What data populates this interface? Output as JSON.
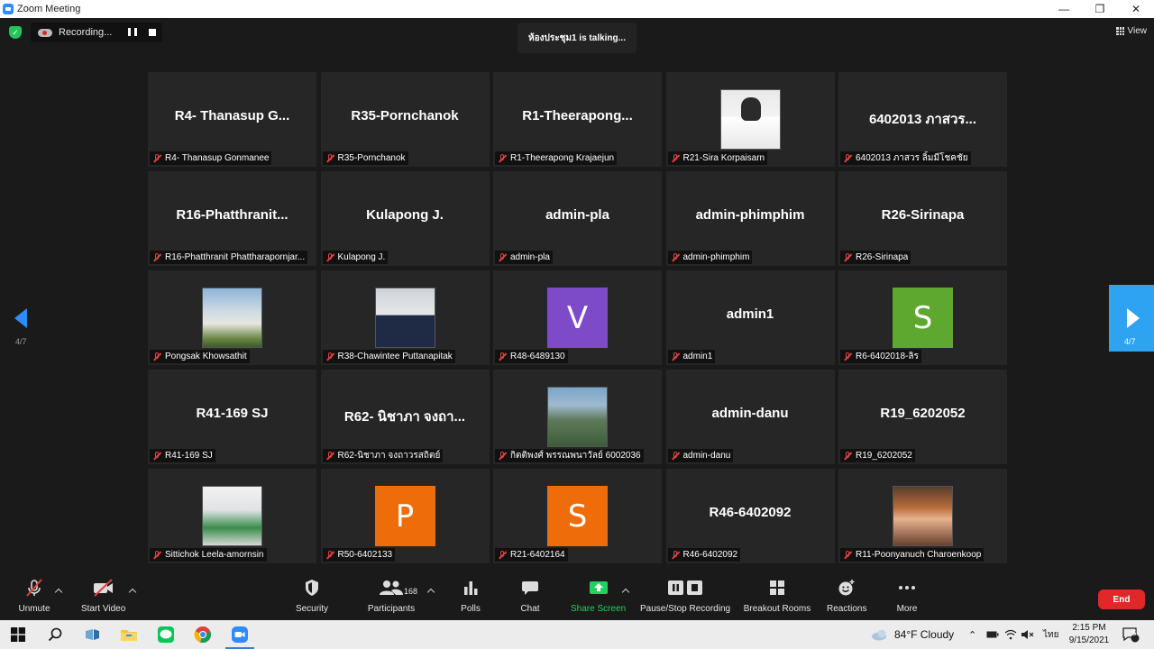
{
  "window": {
    "title": "Zoom Meeting"
  },
  "recording": {
    "label": "Recording..."
  },
  "talking": {
    "text": "ห้องประชุม1 is  talking..."
  },
  "view": {
    "label": "View"
  },
  "pagination": {
    "prev_label": "4/7",
    "next_label": "4/7"
  },
  "participants": [
    {
      "big": "R4- Thanasup G...",
      "label": "R4- Thanasup Gonmanee"
    },
    {
      "big": "R35-Pornchanok",
      "label": "R35-Pornchanok"
    },
    {
      "big": "R1-Theerapong...",
      "label": "R1-Theerapong Krajaejun"
    },
    {
      "photo": "doc",
      "label": "R21-Sira Korpaisarn"
    },
    {
      "big": "6402013 ภาสวร...",
      "label": "6402013 ภาสวร ลิ้มมีโชคชัย"
    },
    {
      "big": "R16-Phatthranit...",
      "label": "R16-Phatthranit Phattharapornjar..."
    },
    {
      "big": "Kulapong J.",
      "label": "Kulapong J."
    },
    {
      "big": "admin-pla",
      "label": "admin-pla"
    },
    {
      "big": "admin-phimphim",
      "label": "admin-phimphim"
    },
    {
      "big": "R26-Sirinapa",
      "label": "R26-Sirinapa"
    },
    {
      "photo": "taj",
      "label": "Pongsak Khowsathit"
    },
    {
      "photo": "suit",
      "label": "R38-Chawintee Puttanapitak"
    },
    {
      "letter": "V",
      "color": "#7e4bc8",
      "label": "R48-6489130"
    },
    {
      "big": "admin1",
      "label": "admin1"
    },
    {
      "letter": "S",
      "color": "#5fa82f",
      "label": "R6-6402018-ลิร"
    },
    {
      "big": "R41-169 SJ",
      "label": "R41-169 SJ"
    },
    {
      "big": "R62- นิชาภา จงถา...",
      "label": "R62-นิชาภา จงถาวรสถิตย์"
    },
    {
      "photo": "mountain",
      "label": "กิตติพงศ์ พรรณพนาวัลย์ 6002036"
    },
    {
      "big": "admin-danu",
      "label": "admin-danu"
    },
    {
      "big": "R19_6202052",
      "label": "R19_6202052"
    },
    {
      "photo": "ambulance",
      "label": "Sittichok Leela-amornsin"
    },
    {
      "letter": "P",
      "color": "#ef6c0b",
      "label": "R50-6402133"
    },
    {
      "letter": "S",
      "color": "#ef6c0b",
      "label": "R21-6402164"
    },
    {
      "big": "R46-6402092",
      "label": "R46-6402092"
    },
    {
      "photo": "mickey",
      "label": "R11-Poonyanuch Charoenkoop"
    }
  ],
  "toolbar": {
    "unmute": "Unmute",
    "start_video": "Start Video",
    "security": "Security",
    "participants": "Participants",
    "participants_count": "168",
    "polls": "Polls",
    "chat": "Chat",
    "share_screen": "Share Screen",
    "pause_stop_recording": "Pause/Stop Recording",
    "breakout_rooms": "Breakout Rooms",
    "reactions": "Reactions",
    "more": "More",
    "end": "End"
  },
  "taskbar": {
    "weather": "84°F  Cloudy",
    "language": "ไทย",
    "time": "2:15 PM",
    "date": "9/15/2021",
    "notification_count": "5"
  },
  "colors": {
    "accent": "#2d8cff",
    "share_green": "#23d160",
    "end_red": "#e02828"
  }
}
